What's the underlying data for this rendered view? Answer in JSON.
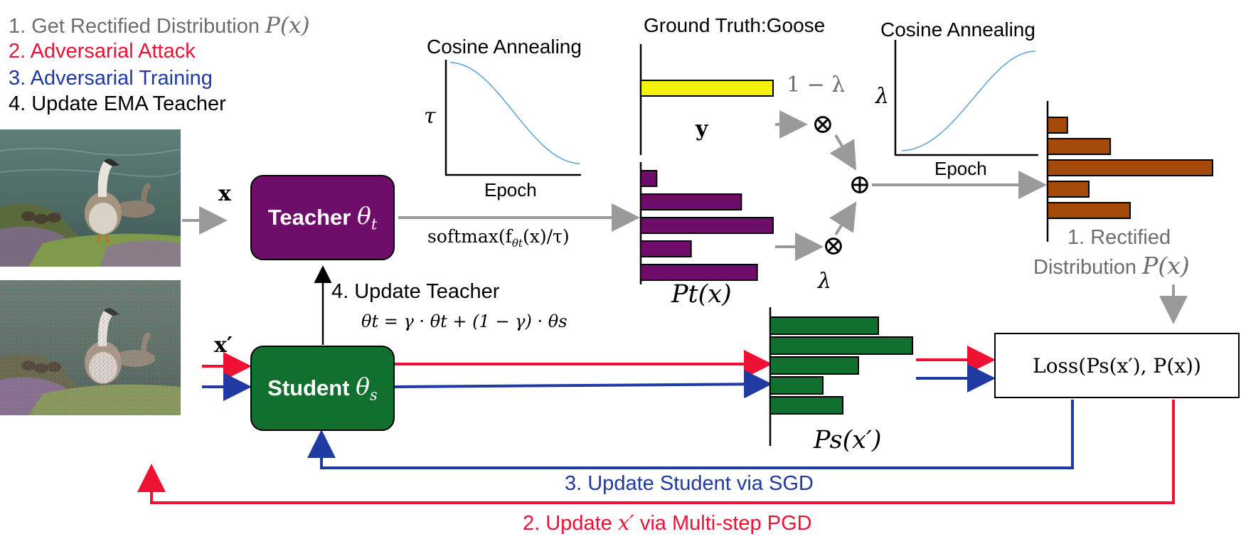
{
  "legend": {
    "item1": "1. Get Rectified Distribution",
    "item1_math": "P(x)",
    "item2": "2. Adversarial Attack",
    "item3": "3. Adversarial Training",
    "item4": "4. Update EMA Teacher"
  },
  "colors": {
    "gray": "#6d6d6d",
    "red": "#ee1133",
    "blue": "#1f3aa0",
    "black": "#000000",
    "teacher": "#6f0e6a",
    "student": "#12702f",
    "truth_bar": "#f4f20a",
    "rectified": "#a34a0a",
    "curve": "#5aa0d8",
    "arrow_gray": "#9a9a9a"
  },
  "inputs": {
    "clean_label": "x",
    "adv_label": "x′"
  },
  "teacher": {
    "label": "Teacher",
    "param": "θ",
    "param_sub": "t"
  },
  "student": {
    "label": "Student",
    "param": "θ",
    "param_sub": "s"
  },
  "softmax_label": "softmax(f",
  "softmax_sub": "θt",
  "softmax_tail": "(x)/τ)",
  "update_teacher": {
    "label": "4. Update Teacher",
    "formula": "θt = γ · θt + (1 − γ) · θs"
  },
  "cosine_tau": {
    "title": "Cosine Annealing",
    "ylabel": "τ",
    "xlabel": "Epoch"
  },
  "cosine_lambda": {
    "title": "Cosine Annealing",
    "ylabel": "λ",
    "xlabel": "Epoch"
  },
  "ground_truth": {
    "title": "Ground Truth:Goose",
    "label": "y"
  },
  "teacher_dist_label": "Pt(x)",
  "student_dist_label": "Ps(x′)",
  "mix": {
    "one_minus_lambda": "1 − λ",
    "lambda": "λ",
    "otimes": "⊗",
    "oplus": "⊕"
  },
  "rectified_label": {
    "line1": "1. Rectified",
    "line2": "Distribution",
    "math": "P(x)"
  },
  "loss_label": "Loss(Ps(x′), P(x))",
  "update_student": "3. Update Student via SGD",
  "update_adv": "2. Update",
  "update_adv_math": "x′",
  "update_adv_tail": "via Multi-step PGD",
  "chart_data": [
    {
      "type": "bar",
      "orientation": "horizontal",
      "name": "ground_truth",
      "values": [
        1.0
      ]
    },
    {
      "type": "bar",
      "orientation": "horizontal",
      "name": "teacher_distribution",
      "values": [
        0.12,
        0.76,
        1.0,
        0.38,
        0.88
      ]
    },
    {
      "type": "bar",
      "orientation": "horizontal",
      "name": "rectified_distribution",
      "values": [
        0.12,
        0.38,
        1.0,
        0.25,
        0.5
      ]
    },
    {
      "type": "bar",
      "orientation": "horizontal",
      "name": "student_distribution",
      "values": [
        0.76,
        1.0,
        0.62,
        0.37,
        0.51
      ]
    }
  ]
}
